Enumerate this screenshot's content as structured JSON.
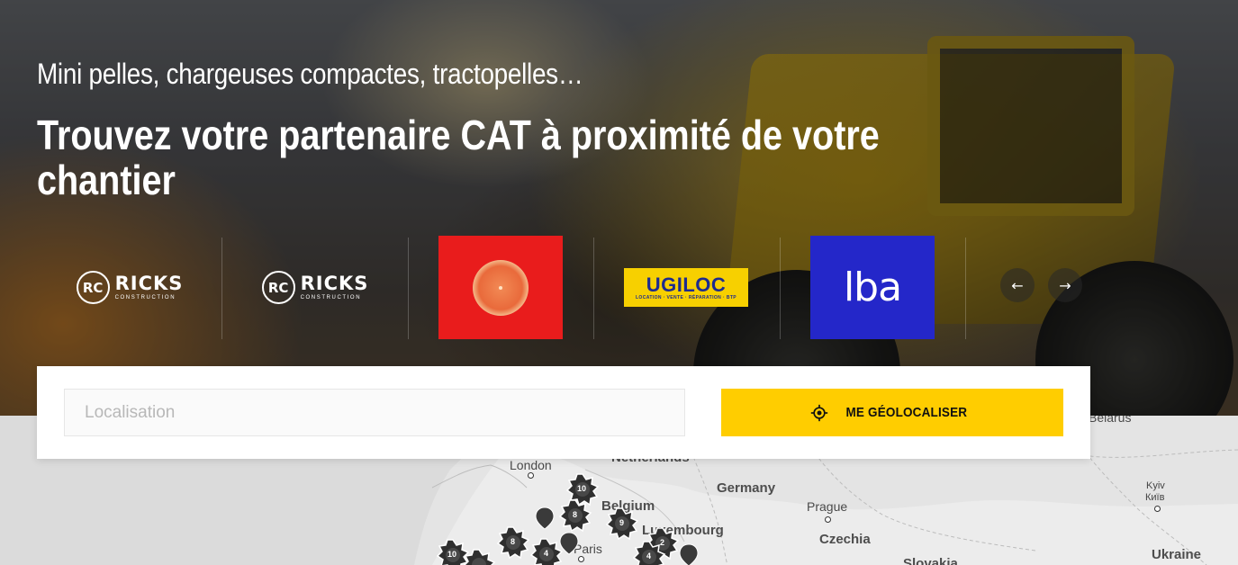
{
  "hero": {
    "subtitle": "Mini pelles, chargeuses compactes, tractopelles…",
    "headline": "Trouvez votre partenaire CAT à proximité de votre chantier"
  },
  "carousel": {
    "partners": [
      {
        "name": "RICKS",
        "tagline": "CONSTRUCTION",
        "badge": "RC"
      },
      {
        "name": "RICKS",
        "tagline": "CONSTRUCTION",
        "badge": "RC"
      },
      {
        "name": "orange-logo"
      },
      {
        "name": "UGILOC",
        "tagline": "LOCATION · VENTE · RÉPARATION · BTP"
      },
      {
        "name": "lba"
      }
    ],
    "prev_icon": "←",
    "next_icon": "→"
  },
  "search": {
    "placeholder": "Localisation",
    "geolocate_label": "ME GÉOLOCALISER"
  },
  "map": {
    "labels": {
      "london": "London",
      "netherlands": "Netherlands",
      "belgium": "Belgium",
      "germany": "Germany",
      "luxembourg": "Luxembourg",
      "paris": "Paris",
      "prague": "Prague",
      "czechia": "Czechia",
      "slovakia": "Slovakia",
      "belarus": "Belarus",
      "kyiv": "Kyiv",
      "kyiv_local": "Київ",
      "ukraine": "Ukraine"
    },
    "clusters": [
      "10",
      "8",
      "9",
      "8",
      "4",
      "2",
      "10",
      "4"
    ]
  },
  "colors": {
    "accent": "#ffcd00",
    "orange_brand": "#e91c1c",
    "lba_brand": "#2427c9",
    "ugiloc_brand": "#f7d000"
  }
}
